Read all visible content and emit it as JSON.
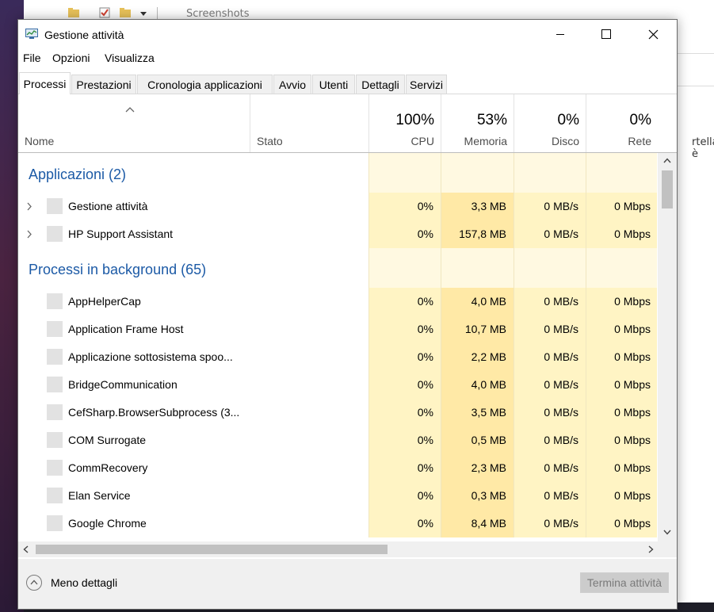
{
  "background": {
    "explorer_title": "Screenshots",
    "explorer_side_text": "rtella è"
  },
  "window": {
    "title": "Gestione attività"
  },
  "menu": [
    "File",
    "Opzioni",
    "Visualizza"
  ],
  "tabs": [
    "Processi",
    "Prestazioni",
    "Cronologia applicazioni",
    "Avvio",
    "Utenti",
    "Dettagli",
    "Servizi"
  ],
  "header": {
    "name": "Nome",
    "status": "Stato",
    "cpu": {
      "pct": "100%",
      "label": "CPU"
    },
    "memory": {
      "pct": "53%",
      "label": "Memoria"
    },
    "disk": {
      "pct": "0%",
      "label": "Disco"
    },
    "net": {
      "pct": "0%",
      "label": "Rete"
    }
  },
  "groups": {
    "apps": {
      "title": "Applicazioni (2)",
      "rows": [
        {
          "name": "Gestione attività",
          "cpu": "0%",
          "mem": "3,3 MB",
          "disk": "0 MB/s",
          "net": "0 Mbps"
        },
        {
          "name": "HP Support Assistant",
          "cpu": "0%",
          "mem": "157,8 MB",
          "disk": "0 MB/s",
          "net": "0 Mbps"
        }
      ]
    },
    "background": {
      "title": "Processi in background (65)",
      "rows": [
        {
          "name": "AppHelperCap",
          "cpu": "0%",
          "mem": "4,0 MB",
          "disk": "0 MB/s",
          "net": "0 Mbps"
        },
        {
          "name": "Application Frame Host",
          "cpu": "0%",
          "mem": "10,7 MB",
          "disk": "0 MB/s",
          "net": "0 Mbps"
        },
        {
          "name": "Applicazione sottosistema spoo...",
          "cpu": "0%",
          "mem": "2,2 MB",
          "disk": "0 MB/s",
          "net": "0 Mbps"
        },
        {
          "name": "BridgeCommunication",
          "cpu": "0%",
          "mem": "4,0 MB",
          "disk": "0 MB/s",
          "net": "0 Mbps"
        },
        {
          "name": "CefSharp.BrowserSubprocess (3...",
          "cpu": "0%",
          "mem": "3,5 MB",
          "disk": "0 MB/s",
          "net": "0 Mbps"
        },
        {
          "name": "COM Surrogate",
          "cpu": "0%",
          "mem": "0,5 MB",
          "disk": "0 MB/s",
          "net": "0 Mbps"
        },
        {
          "name": "CommRecovery",
          "cpu": "0%",
          "mem": "2,3 MB",
          "disk": "0 MB/s",
          "net": "0 Mbps"
        },
        {
          "name": "Elan Service",
          "cpu": "0%",
          "mem": "0,3 MB",
          "disk": "0 MB/s",
          "net": "0 Mbps"
        },
        {
          "name": "Google Chrome",
          "cpu": "0%",
          "mem": "8,4 MB",
          "disk": "0 MB/s",
          "net": "0 Mbps"
        }
      ]
    }
  },
  "footer": {
    "less_details": "Meno dettagli",
    "end_task": "Termina attività"
  },
  "colors": {
    "group_title": "#1c5aa6",
    "heat_light": "#fff4c4",
    "heat_mem": "#ffe9a6",
    "heat_group": "#fff9e1"
  }
}
